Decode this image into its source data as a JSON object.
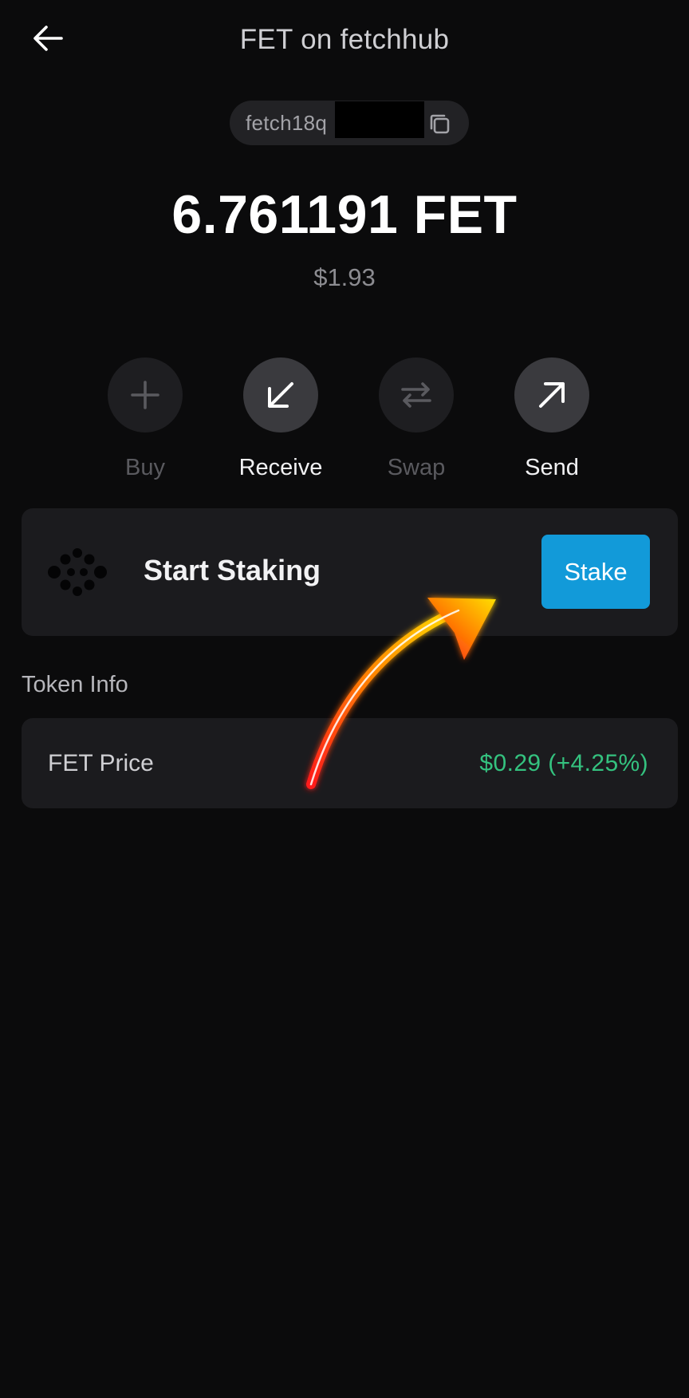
{
  "header": {
    "title": "FET on fetchhub"
  },
  "address": {
    "prefix": "fetch18q"
  },
  "balance": {
    "amount": "6.761191 FET",
    "fiat": "$1.93"
  },
  "actions": [
    {
      "label": "Buy",
      "icon": "plus-icon",
      "enabled": false
    },
    {
      "label": "Receive",
      "icon": "arrow-down-left-icon",
      "enabled": true
    },
    {
      "label": "Swap",
      "icon": "swap-arrows-icon",
      "enabled": false
    },
    {
      "label": "Send",
      "icon": "arrow-up-right-icon",
      "enabled": true
    }
  ],
  "staking": {
    "text": "Start Staking",
    "button_label": "Stake",
    "logo": "fetch-ai-logo"
  },
  "token_info": {
    "title": "Token Info",
    "price_label": "FET Price",
    "price_value": "$0.29 (+4.25%)"
  },
  "colors": {
    "background": "#0b0b0c",
    "card": "#1b1b1e",
    "accent": "#129ad9",
    "positive": "#34c27f"
  }
}
